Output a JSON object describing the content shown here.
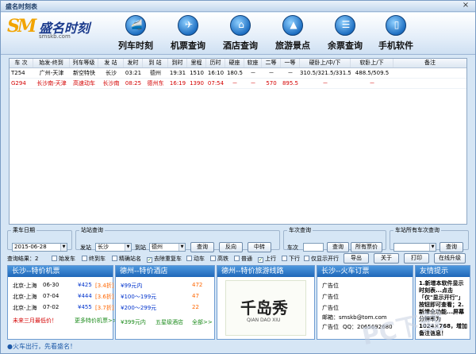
{
  "window": {
    "title": "盛名时刻表",
    "close": "×"
  },
  "logo": {
    "mark": "SM",
    "name": "盛名时刻",
    "url": "smskb.com"
  },
  "nav": [
    {
      "label": "列车时刻",
      "icon": "train-icon",
      "glyph": "🚄"
    },
    {
      "label": "机票查询",
      "icon": "plane-icon",
      "glyph": "✈"
    },
    {
      "label": "酒店查询",
      "icon": "hotel-icon",
      "glyph": "⌂"
    },
    {
      "label": "旅游景点",
      "icon": "mountain-icon",
      "glyph": "▲"
    },
    {
      "label": "余票查询",
      "icon": "ticket-icon",
      "glyph": "☰"
    },
    {
      "label": "手机软件",
      "icon": "phone-icon",
      "glyph": "▯"
    }
  ],
  "table": {
    "headers": [
      "车 次",
      "始发-终到",
      "列车等级",
      "发  站",
      "发时",
      "到  站",
      "到时",
      "里程",
      "历时",
      "硬座",
      "软座",
      "二等",
      "一等",
      "硬卧上/中/下",
      "软卧上/下",
      "备注"
    ],
    "rows": [
      {
        "color": "black",
        "cells": [
          "T254",
          "广州-天津",
          "新空特快",
          "长沙",
          "03:21",
          "德州",
          "19:31",
          "1510",
          "16:10",
          "180.5",
          "－",
          "－",
          "－",
          "310.5/321.5/331.5",
          "488.5/509.5",
          ""
        ]
      },
      {
        "color": "red",
        "cells": [
          "G294",
          "长沙南-天津",
          "高速动车",
          "长沙南",
          "08:25",
          "德州东",
          "16:19",
          "1390",
          "07:54",
          "－",
          "－",
          "570",
          "895.5",
          "－",
          "－",
          ""
        ]
      }
    ]
  },
  "search": {
    "date": {
      "legend": "乘车日期",
      "value": "2015-06-28"
    },
    "station": {
      "legend": "站站查询",
      "from_label": "发站",
      "from_value": "长沙",
      "to_label": "到站",
      "to_value": "德州",
      "query": "查询",
      "reverse": "反向",
      "transfer": "中转"
    },
    "train": {
      "legend": "车次查询",
      "label": "车次",
      "value": "",
      "query": "查询",
      "all_fares": "所有票价"
    },
    "all": {
      "legend": "车站所有车次查询",
      "value": "",
      "query": "查询"
    }
  },
  "options": {
    "result": "查询结果：2",
    "checks": [
      {
        "label": "始发车",
        "checked": false
      },
      {
        "label": "终到车",
        "checked": false
      },
      {
        "label": "精确站名",
        "checked": false
      },
      {
        "label": "去除重复车",
        "checked": true
      },
      {
        "label": "动车",
        "checked": false
      },
      {
        "label": "高铁",
        "checked": false
      },
      {
        "label": "普通",
        "checked": false
      },
      {
        "label": "上行",
        "checked": true
      },
      {
        "label": "下行",
        "checked": false
      },
      {
        "label": "仅显示开行",
        "checked": false
      }
    ],
    "buttons": [
      "导出",
      "关于",
      "打印",
      "在线升级"
    ]
  },
  "panels": {
    "flights": {
      "title": "长沙--特价机票",
      "rows": [
        {
          "route": "北京-上海",
          "date": "06-30",
          "price": "¥425",
          "discount": "[3.4折]"
        },
        {
          "route": "北京-上海",
          "date": "07-04",
          "price": "¥444",
          "discount": "[3.6折]"
        },
        {
          "route": "北京-上海",
          "date": "07-02",
          "price": "¥455",
          "discount": "[3.7折]"
        }
      ],
      "promo": "未来三月最低价！",
      "more": "更多特价机票>>"
    },
    "hotels": {
      "title": "德州--特价酒店",
      "rows": [
        {
          "price": "¥99元内",
          "count": "472"
        },
        {
          "price": "¥100～199元",
          "count": "47"
        },
        {
          "price": "¥200～299元",
          "count": "22"
        }
      ],
      "footer": "¥399元内",
      "star": "五星级酒店",
      "all": "全部>>"
    },
    "tourism": {
      "title": "德州--特价旅游线路",
      "brand": "千岛秀",
      "brand_sub": "QIAN DAO XIU"
    },
    "booking": {
      "title": "长沙--火车订票",
      "rows": [
        "广告位",
        "广告位",
        "广告位"
      ],
      "email": "邮箱：smskb@tom.com",
      "ad": "广告位",
      "qq": "QQ：2065692680"
    },
    "tips": {
      "title": "友情提示",
      "text": "1.新增本软件显示时刻表...点击「仅\"显示开行\"」按钮即可查看；2.新增全功能...屏幕分辨率为1024×768，增加备注信息！"
    }
  },
  "footer": "●火车出行，先看盛名！",
  "watermark": "PC下载"
}
